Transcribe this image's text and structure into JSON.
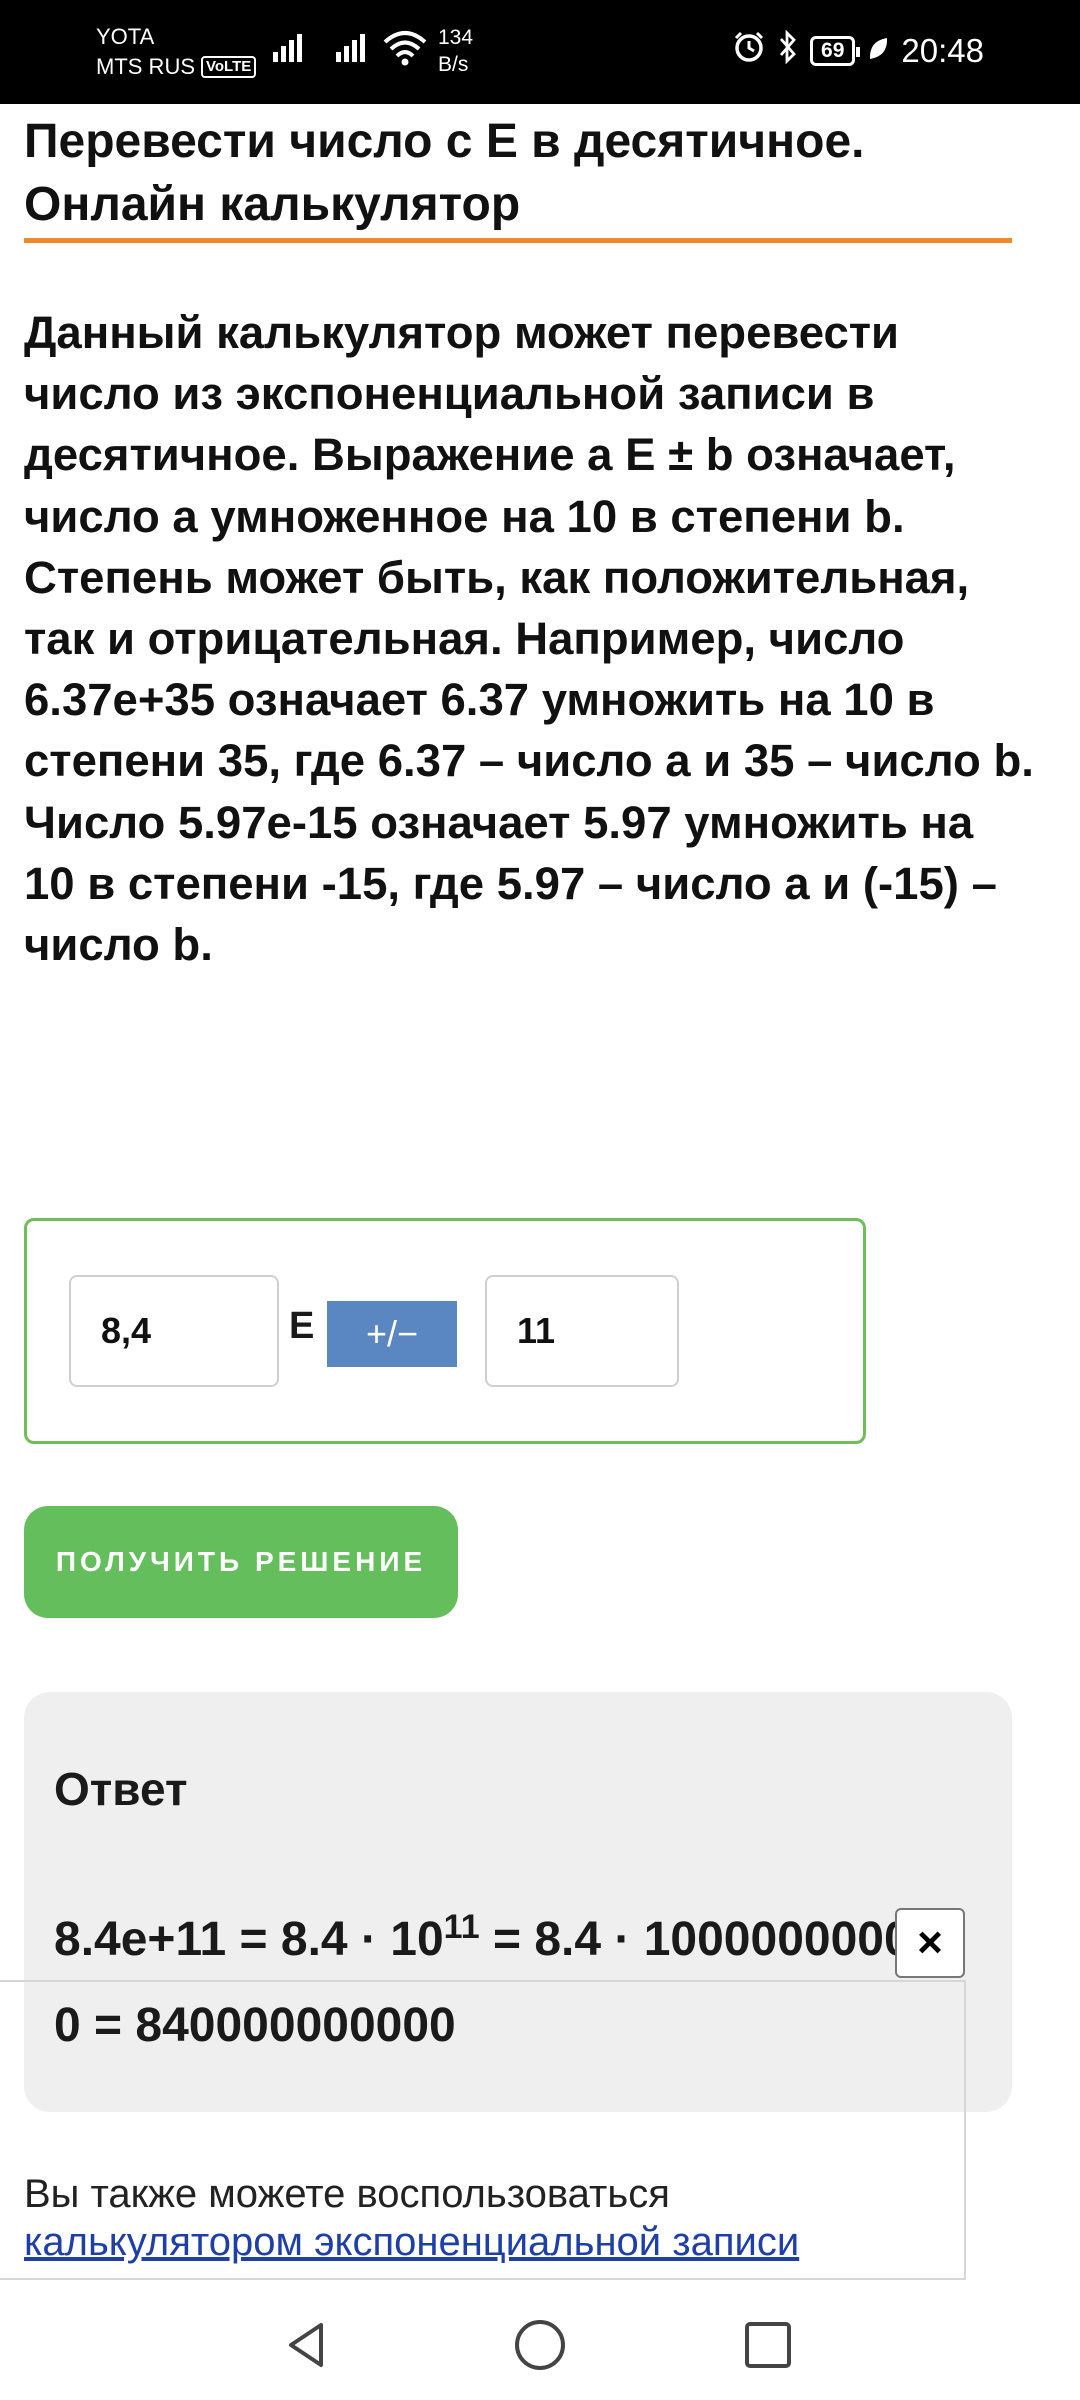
{
  "status_bar": {
    "carrier1": "YOTA",
    "carrier2": "MTS RUS",
    "volte": "VoLTE",
    "net_speed_value": "134",
    "net_speed_unit": "B/s",
    "battery": "69",
    "time": "20:48",
    "icons": [
      "signal-icon",
      "signal-icon",
      "wifi-icon",
      "alarm-icon",
      "bluetooth-icon",
      "battery-icon",
      "leaf-icon"
    ]
  },
  "page": {
    "title": "Перевести число с E в десятичное. Онлайн калькулятор",
    "description": "Данный калькулятор может перевести число из экспоненциальной записи в десятичное. Выражение a E ± b означает, число a умноженное на 10 в степени b. Степень может быть, как положительная, так и отрицательная. Например, число 6.37e+35 означает 6.37 умножить на 10 в степени 35, где 6.37 – число a и 35 – число b. Число 5.97e-15 означает 5.97 умножить на 10 в степени -15, где 5.97 – число a и (-15) – число b."
  },
  "calculator": {
    "mantissa_value": "8,4",
    "e_label": "E",
    "sign_button": "+/−",
    "exponent_value": "11",
    "solve_button": "ПОЛУЧИТЬ РЕШЕНИЕ"
  },
  "answer": {
    "heading": "Ответ",
    "left": "8.4e+11 = 8.4 · 10",
    "exponent": "11",
    "right": " = 8.4 · 100000000000 = 840000000000"
  },
  "ad": {
    "close_label": "×"
  },
  "footer": {
    "text": "Вы также можете воспользоваться",
    "link": "калькулятором экспоненциальной записи"
  },
  "nav": {
    "icons": [
      "back-icon",
      "home-icon",
      "recent-apps-icon"
    ]
  },
  "colors": {
    "accent_rule": "#f0892a",
    "calc_border": "#6fbe59",
    "sign_button": "#5a86c2",
    "solve_button": "#63be5b",
    "answer_bg": "#efefef",
    "link": "#1f3fa8"
  }
}
